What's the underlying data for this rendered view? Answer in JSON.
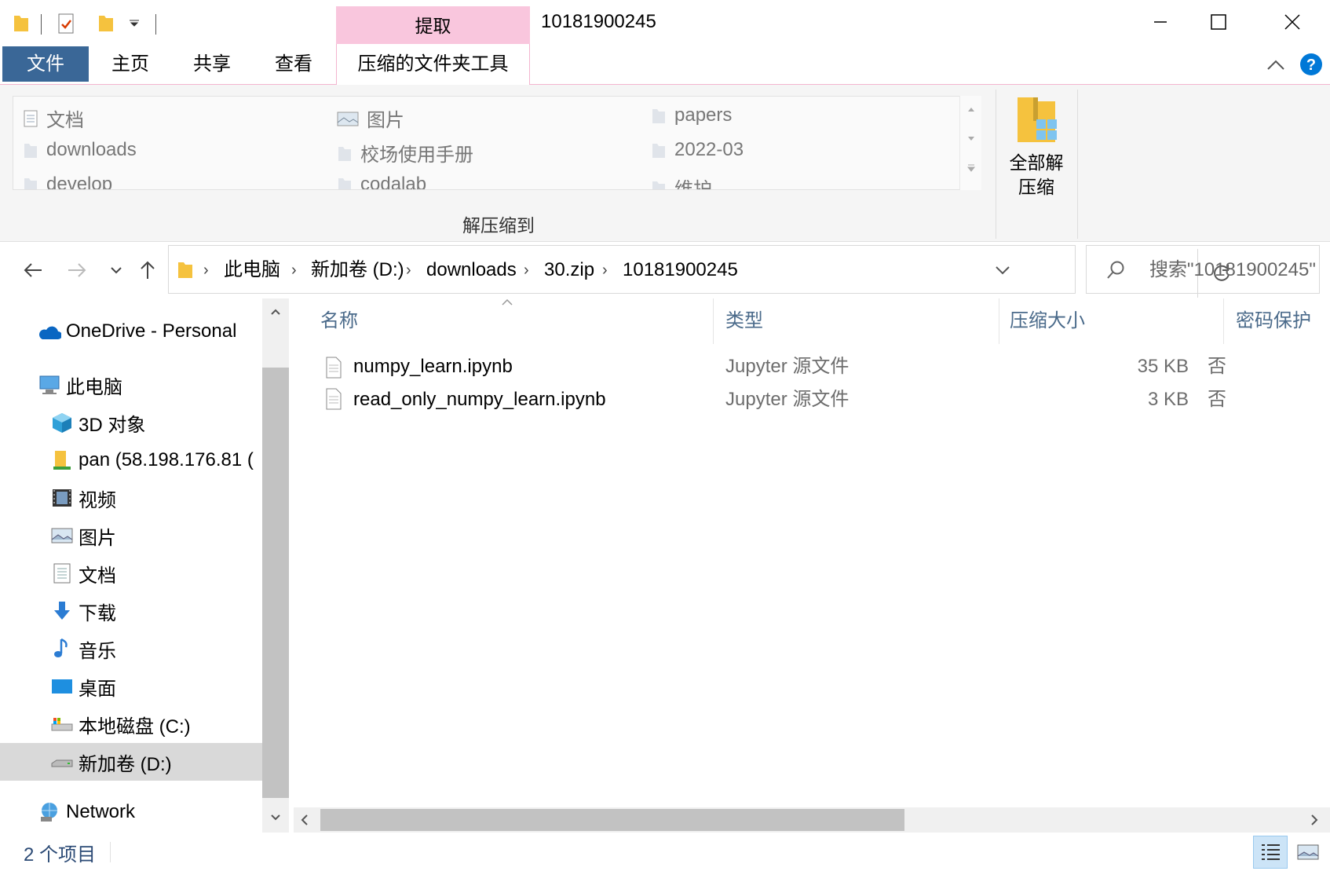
{
  "window": {
    "title": "10181900245",
    "context_tab_header": "提取",
    "controls": {
      "minimize": "minimize-icon",
      "maximize": "maximize-icon",
      "close": "close-icon"
    }
  },
  "ribbon": {
    "tabs": [
      "文件",
      "主页",
      "共享",
      "查看",
      "压缩的文件夹工具"
    ],
    "active_tab": "压缩的文件夹工具",
    "gallery": [
      [
        "文档",
        "图片",
        "papers"
      ],
      [
        "downloads",
        "校场使用手册",
        "2022-03"
      ],
      [
        "develop",
        "codalab",
        "维护"
      ]
    ],
    "group_label": "解压缩到",
    "extract_all_line1": "全部解",
    "extract_all_line2": "压缩"
  },
  "address": {
    "crumbs": [
      "此电脑",
      "新加卷 (D:)",
      "downloads",
      "30.zip",
      "10181900245"
    ],
    "search_placeholder": "搜索\"10181900245\""
  },
  "nav": {
    "items": [
      {
        "label": "OneDrive - Personal",
        "icon": "onedrive-cloud-icon"
      },
      {
        "label": "此电脑",
        "icon": "this-pc-icon"
      },
      {
        "label": "3D 对象",
        "icon": "3d-objects-icon"
      },
      {
        "label": "pan (58.198.176.81 (",
        "icon": "network-drive-icon"
      },
      {
        "label": "视频",
        "icon": "video-icon"
      },
      {
        "label": "图片",
        "icon": "pictures-icon"
      },
      {
        "label": "文档",
        "icon": "documents-icon"
      },
      {
        "label": "下载",
        "icon": "downloads-icon"
      },
      {
        "label": "音乐",
        "icon": "music-icon"
      },
      {
        "label": "桌面",
        "icon": "desktop-icon"
      },
      {
        "label": "本地磁盘 (C:)",
        "icon": "local-disk-icon"
      },
      {
        "label": "新加卷 (D:)",
        "icon": "drive-icon"
      },
      {
        "label": "Network",
        "icon": "network-icon"
      }
    ],
    "selected": "新加卷 (D:)"
  },
  "columns": [
    "名称",
    "类型",
    "压缩大小",
    "密码保护"
  ],
  "files": [
    {
      "name": "numpy_learn.ipynb",
      "type": "Jupyter 源文件",
      "size": "35 KB",
      "password": "否"
    },
    {
      "name": "read_only_numpy_learn.ipynb",
      "type": "Jupyter 源文件",
      "size": "3 KB",
      "password": "否"
    }
  ],
  "status": {
    "item_count": "2 个项目"
  },
  "colors": {
    "accent": "#0078d7",
    "file_tab": "#3a6797",
    "context_tab": "#f9c6dd",
    "selected": "#d9d9d9"
  }
}
